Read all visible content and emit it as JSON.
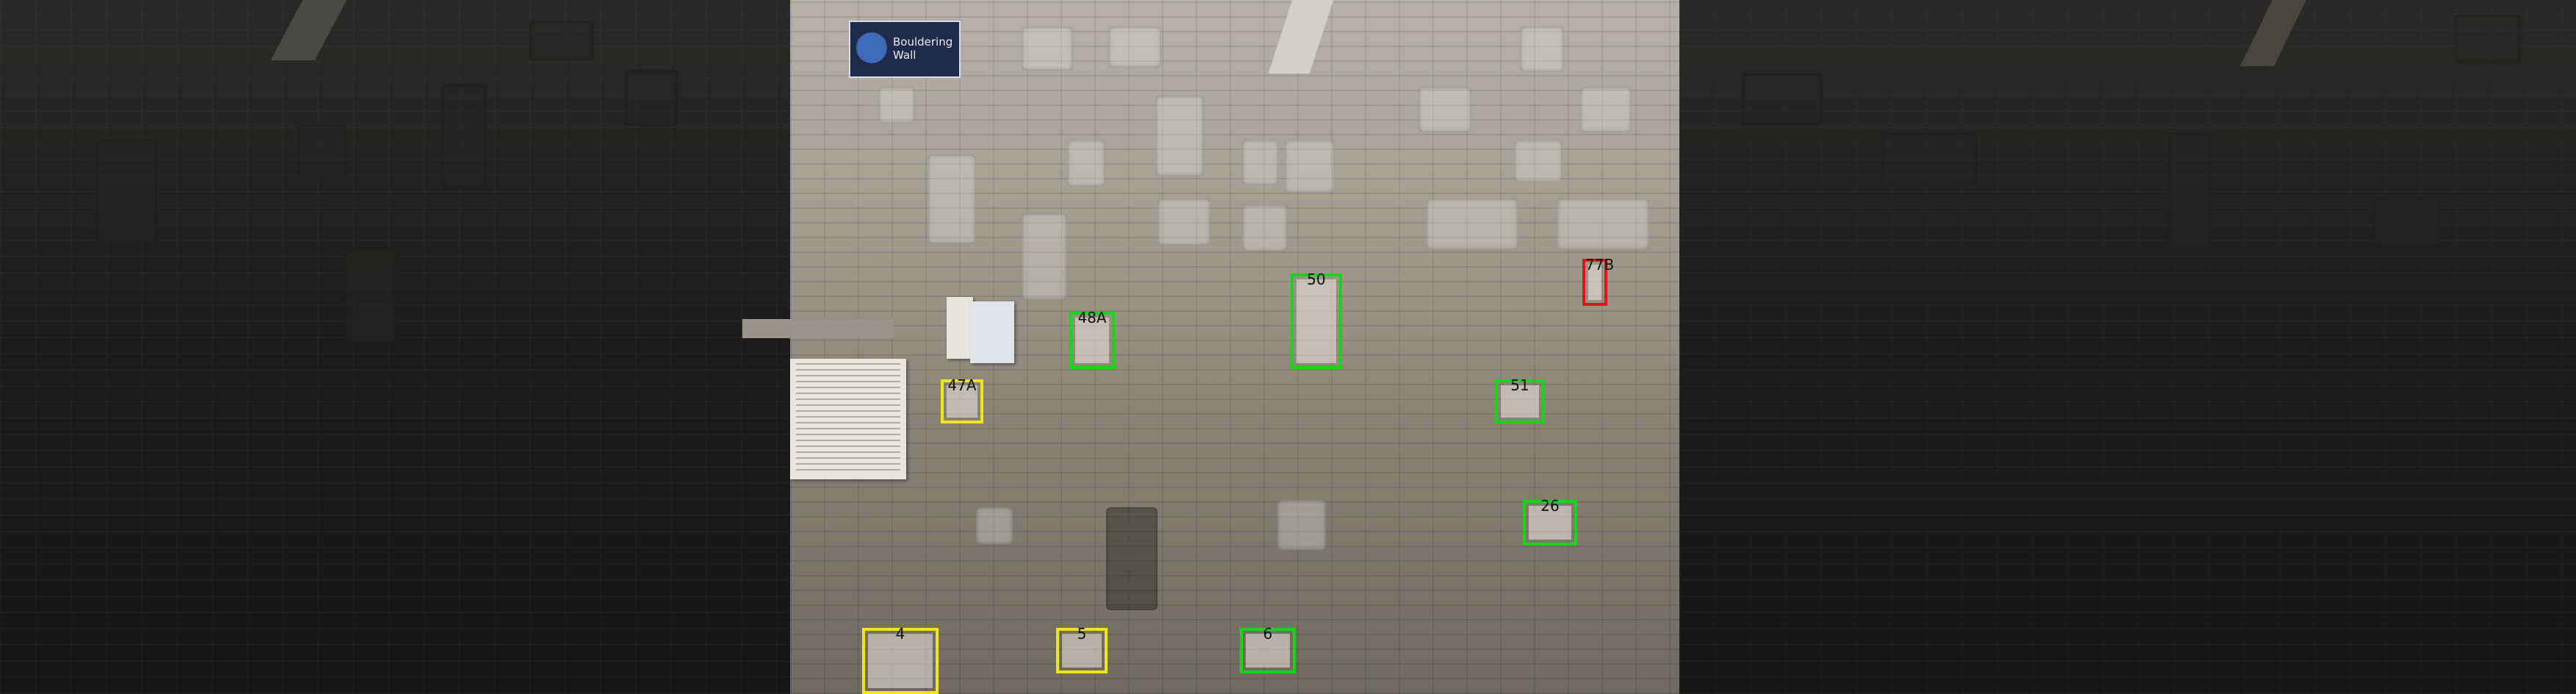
{
  "sign": {
    "title": "Bouldering\nWall"
  },
  "holds": [
    {
      "label": "47A",
      "color": "yellow"
    },
    {
      "label": "48A",
      "color": "green"
    },
    {
      "label": "50",
      "color": "green"
    },
    {
      "label": "77B",
      "color": "red"
    },
    {
      "label": "51",
      "color": "green"
    },
    {
      "label": "26",
      "color": "green"
    },
    {
      "label": "4",
      "color": "yellow"
    },
    {
      "label": "5",
      "color": "yellow"
    },
    {
      "label": "6",
      "color": "green"
    }
  ],
  "colors": {
    "green": "#19d419",
    "yellow": "#f3e41a",
    "red": "#e0151b"
  }
}
